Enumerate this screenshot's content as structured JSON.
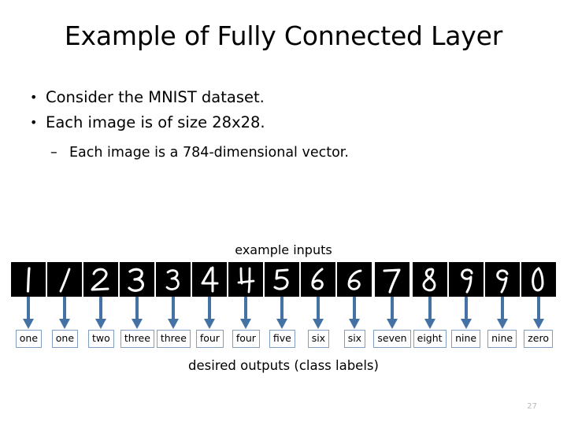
{
  "slide": {
    "title": "Example of Fully Connected Layer",
    "page_number": "27",
    "bullets": [
      {
        "marker": "•",
        "text": "Consider the MNIST dataset."
      },
      {
        "marker": "•",
        "text": "Each image is of size 28x28."
      }
    ],
    "sub_bullets": [
      {
        "marker": "–",
        "text": "Each image is a 784-dimensional vector."
      }
    ]
  },
  "diagram": {
    "caption_top": "example inputs",
    "caption_bottom": "desired outputs (class labels)",
    "arrow_color": "#4472a4",
    "tile_background": "#000000",
    "tile_ink": "#ffffff",
    "label_border_color": "#7f9ec0",
    "columns": [
      {
        "digit": "1",
        "label": "one",
        "variant": "1a"
      },
      {
        "digit": "1",
        "label": "one",
        "variant": "1b"
      },
      {
        "digit": "2",
        "label": "two",
        "variant": "2a"
      },
      {
        "digit": "3",
        "label": "three",
        "variant": "3a"
      },
      {
        "digit": "3",
        "label": "three",
        "variant": "3b"
      },
      {
        "digit": "4",
        "label": "four",
        "variant": "4a"
      },
      {
        "digit": "4",
        "label": "four",
        "variant": "4b"
      },
      {
        "digit": "5",
        "label": "five",
        "variant": "5a"
      },
      {
        "digit": "6",
        "label": "six",
        "variant": "6a"
      },
      {
        "digit": "6",
        "label": "six",
        "variant": "6b"
      },
      {
        "digit": "7",
        "label": "seven",
        "variant": "7a"
      },
      {
        "digit": "8",
        "label": "eight",
        "variant": "8a"
      },
      {
        "digit": "9",
        "label": "nine",
        "variant": "9a"
      },
      {
        "digit": "9",
        "label": "nine",
        "variant": "9b"
      },
      {
        "digit": "0",
        "label": "zero",
        "variant": "0a"
      }
    ]
  }
}
